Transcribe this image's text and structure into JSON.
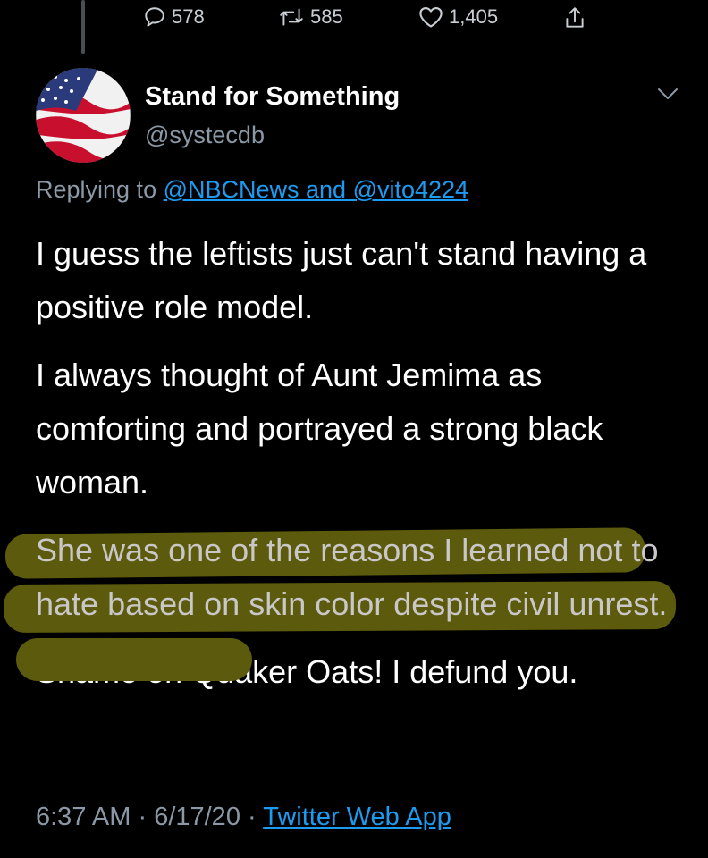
{
  "actions": {
    "reply_count": "578",
    "retweet_count": "585",
    "like_count": "1,405"
  },
  "author": {
    "name": "Stand for Something",
    "handle": "@systecdb"
  },
  "reply": {
    "prefix": "Replying to ",
    "mentions": "@NBCNews and @vito4224"
  },
  "tweet": {
    "p1": "I guess the leftists just can't stand having a positive role model.",
    "p2": "I always thought of Aunt Jemima as comforting and portrayed a strong black woman.",
    "p3": "She was one of the reasons I learned not to hate based on skin color despite civil unrest.",
    "p4": "Shame on Quaker Oats! I defund you."
  },
  "meta": {
    "time": "6:37 AM",
    "sep1": " · ",
    "date": "6/17/20",
    "sep2": " · ",
    "app": "Twitter Web App"
  },
  "colors": {
    "background": "#000000",
    "secondary_text": "#8b98a5",
    "link": "#1d9bf0",
    "highlight": "#5c5a0c"
  }
}
